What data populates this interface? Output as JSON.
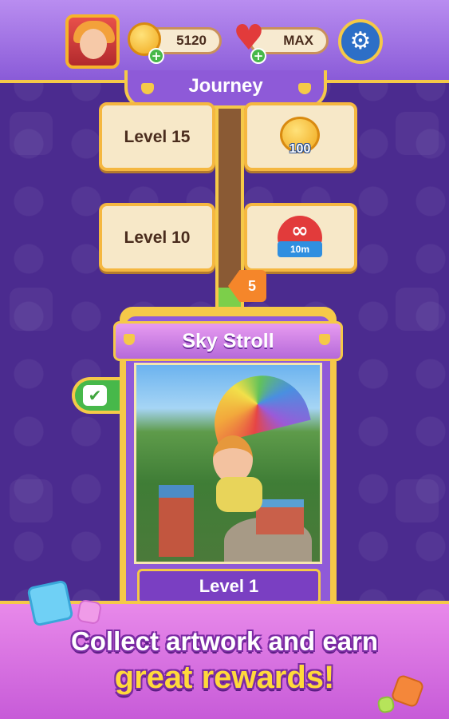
{
  "header": {
    "coins": "5120",
    "lives": "MAX"
  },
  "journey": {
    "title": "Journey"
  },
  "levels": [
    {
      "label": "Level 15",
      "reward_text": "100",
      "reward_icon": "coin-icon"
    },
    {
      "label": "Level 10",
      "reward_text": "10m",
      "reward_icon": "infinite-heart-icon"
    }
  ],
  "progress_marker": "5",
  "artwork": {
    "title": "Sky Stroll",
    "level": "Level 1"
  },
  "banner": {
    "line1": "Collect artwork and earn",
    "line2": "great rewards!"
  },
  "colors": {
    "background": "#4b2b8f",
    "gold": "#f5c948",
    "purple": "#8e5ad8",
    "pink_banner": "#d96de0",
    "yellow_text": "#ffd93b"
  }
}
